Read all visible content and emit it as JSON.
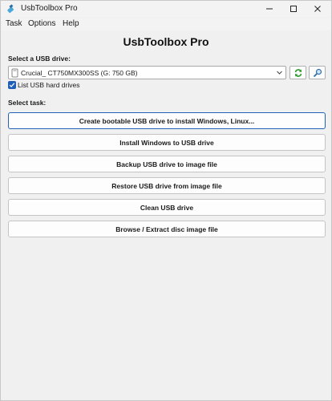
{
  "window": {
    "title": "UsbToolbox Pro",
    "controls": {
      "minimize_icon": "minimize-icon",
      "maximize_icon": "maximize-icon",
      "close_icon": "close-icon"
    }
  },
  "menu": {
    "items": [
      {
        "label": "Task"
      },
      {
        "label": "Options"
      },
      {
        "label": "Help"
      }
    ]
  },
  "main": {
    "heading": "UsbToolbox Pro",
    "drive_section_label": "Select a USB drive:",
    "drive_select": {
      "selected": "Crucial_ CT750MX300SS (G:  750 GB)"
    },
    "list_hard_drives": {
      "label": "List USB hard drives",
      "checked": true
    },
    "task_section_label": "Select task:",
    "tasks": [
      {
        "label": "Create bootable USB drive to install Windows, Linux..."
      },
      {
        "label": "Install Windows to USB drive"
      },
      {
        "label": "Backup USB drive to image file"
      },
      {
        "label": "Restore USB drive from image file"
      },
      {
        "label": "Clean USB drive"
      },
      {
        "label": "Browse / Extract disc image file"
      }
    ]
  },
  "colors": {
    "accent": "#1f5fb8",
    "refresh_green": "#2e9a2e",
    "window_bg": "#f0f0f0"
  }
}
